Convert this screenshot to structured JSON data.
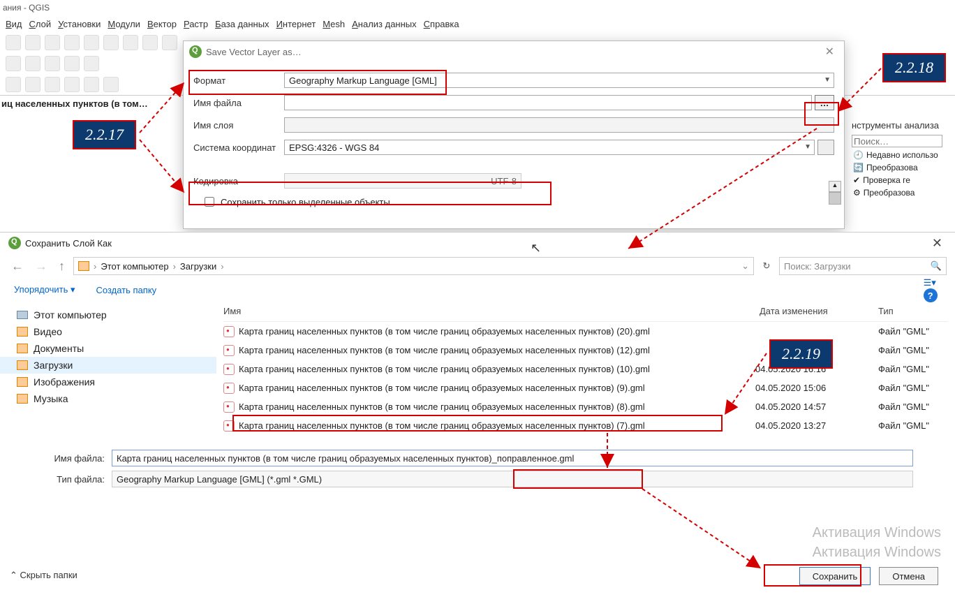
{
  "app": {
    "titlebar": "ания - QGIS"
  },
  "menu": [
    "Вид",
    "Слой",
    "Установки",
    "Модули",
    "Вектор",
    "Растр",
    "База данных",
    "Интернет",
    "Mesh",
    "Анализ данных",
    "Справка"
  ],
  "layer_tree": "иц населенных пунктов (в том…",
  "right_panel": {
    "title": "нструменты анализа",
    "search_ph": "Поиск…",
    "recent": "Недавно использо",
    "items": [
      "Преобразова",
      "Проверка ге",
      "Преобразова"
    ]
  },
  "save_dlg": {
    "title": "Save Vector Layer as…",
    "rows": {
      "format_lbl": "Формат",
      "format_val": "Geography Markup Language [GML]",
      "file_lbl": "Имя файла",
      "layer_lbl": "Имя слоя",
      "crs_lbl": "Система координат",
      "crs_val": "EPSG:4326 - WGS 84",
      "enc_lbl": "Кодировка",
      "enc_val": "UTF-8",
      "only_sel": "Сохранить только выделенные объекты"
    }
  },
  "file_dlg": {
    "title": "Сохранить Слой Как",
    "breadcrumb": [
      "Этот компьютер",
      "Загрузки"
    ],
    "search_ph": "Поиск: Загрузки",
    "organize": "Упорядочить ▾",
    "newfolder": "Создать папку",
    "sidebar": [
      "Этот компьютер",
      "Видео",
      "Документы",
      "Загрузки",
      "Изображения",
      "Музыка"
    ],
    "cols": {
      "name": "Имя",
      "date": "Дата изменения",
      "type": "Тип"
    },
    "rows": [
      {
        "name": "Карта границ населенных пунктов (в том числе границ образуемых населенных пунктов) (20).gml",
        "date": "",
        "type": "Файл \"GML\""
      },
      {
        "name": "Карта границ населенных пунктов (в том числе границ образуемых населенных пунктов) (12).gml",
        "date": "",
        "type": "Файл \"GML\""
      },
      {
        "name": "Карта границ населенных пунктов (в том числе границ образуемых населенных пунктов) (10).gml",
        "date": "04.05.2020 16:16",
        "type": "Файл \"GML\""
      },
      {
        "name": "Карта границ населенных пунктов (в том числе границ образуемых населенных пунктов) (9).gml",
        "date": "04.05.2020 15:06",
        "type": "Файл \"GML\""
      },
      {
        "name": "Карта границ населенных пунктов (в том числе границ образуемых населенных пунктов) (8).gml",
        "date": "04.05.2020 14:57",
        "type": "Файл \"GML\""
      },
      {
        "name": "Карта границ населенных пунктов (в том числе границ образуемых населенных пунктов) (7).gml",
        "date": "04.05.2020 13:27",
        "type": "Файл \"GML\""
      }
    ],
    "fn_lbl": "Имя файла:",
    "fn_val": "Карта границ населенных пунктов (в том числе границ образуемых населенных пунктов)_поправленное.gml",
    "ft_lbl": "Тип файла:",
    "ft_val": "Geography Markup Language [GML] (*.gml *.GML)",
    "hide": "Скрыть папки",
    "save": "Сохранить",
    "cancel": "Отмена"
  },
  "watermark": {
    "l1": "Активация Windows",
    "l2": "Активация Windows"
  },
  "callouts": {
    "a": "2.2.17",
    "b": "2.2.18",
    "c": "2.2.19"
  }
}
